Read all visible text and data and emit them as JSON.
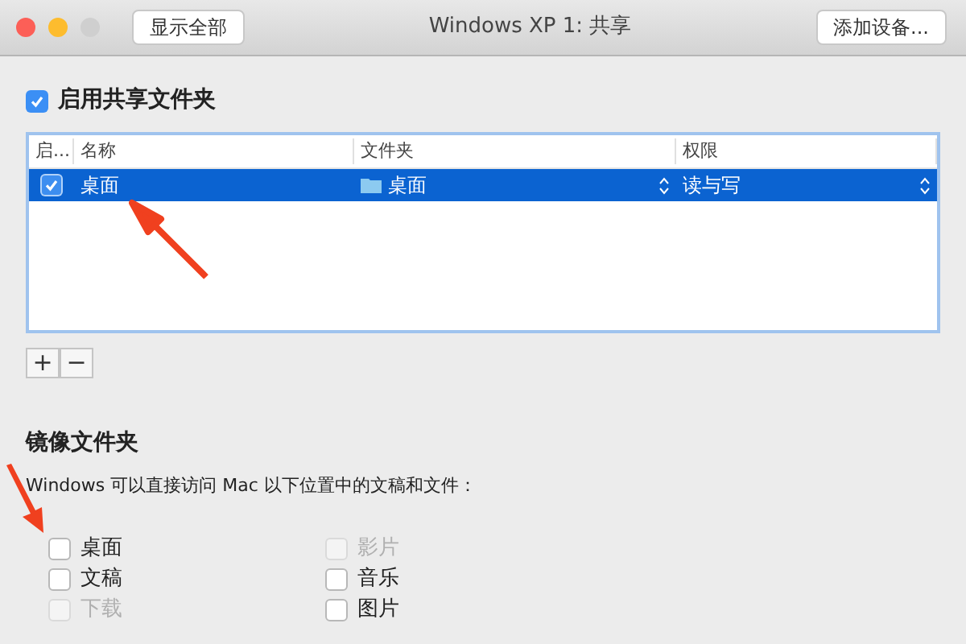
{
  "window": {
    "title": "Windows XP 1: 共享",
    "buttons": [
      "显示全部",
      "添加设备..."
    ]
  },
  "enable_shared": {
    "label": "启用共享文件夹",
    "checked": true
  },
  "table": {
    "columns": [
      "启...",
      "名称",
      "文件夹",
      "权限"
    ],
    "rows": [
      {
        "enabled": true,
        "name": "桌面",
        "folder": "桌面",
        "permission": "读与写",
        "selected": true
      }
    ]
  },
  "table_buttons": [
    "+",
    "−"
  ],
  "mirror": {
    "title": "镜像文件夹",
    "description": "Windows 可以直接访问 Mac 以下位置中的文稿和文件：",
    "items": [
      {
        "label": "桌面",
        "checked": false,
        "disabled": false
      },
      {
        "label": "文稿",
        "checked": false,
        "disabled": false
      },
      {
        "label": "下载",
        "checked": false,
        "disabled": true
      },
      {
        "label": "影片",
        "checked": false,
        "disabled": true
      },
      {
        "label": "音乐",
        "checked": false,
        "disabled": false
      },
      {
        "label": "图片",
        "checked": false,
        "disabled": false
      }
    ]
  }
}
